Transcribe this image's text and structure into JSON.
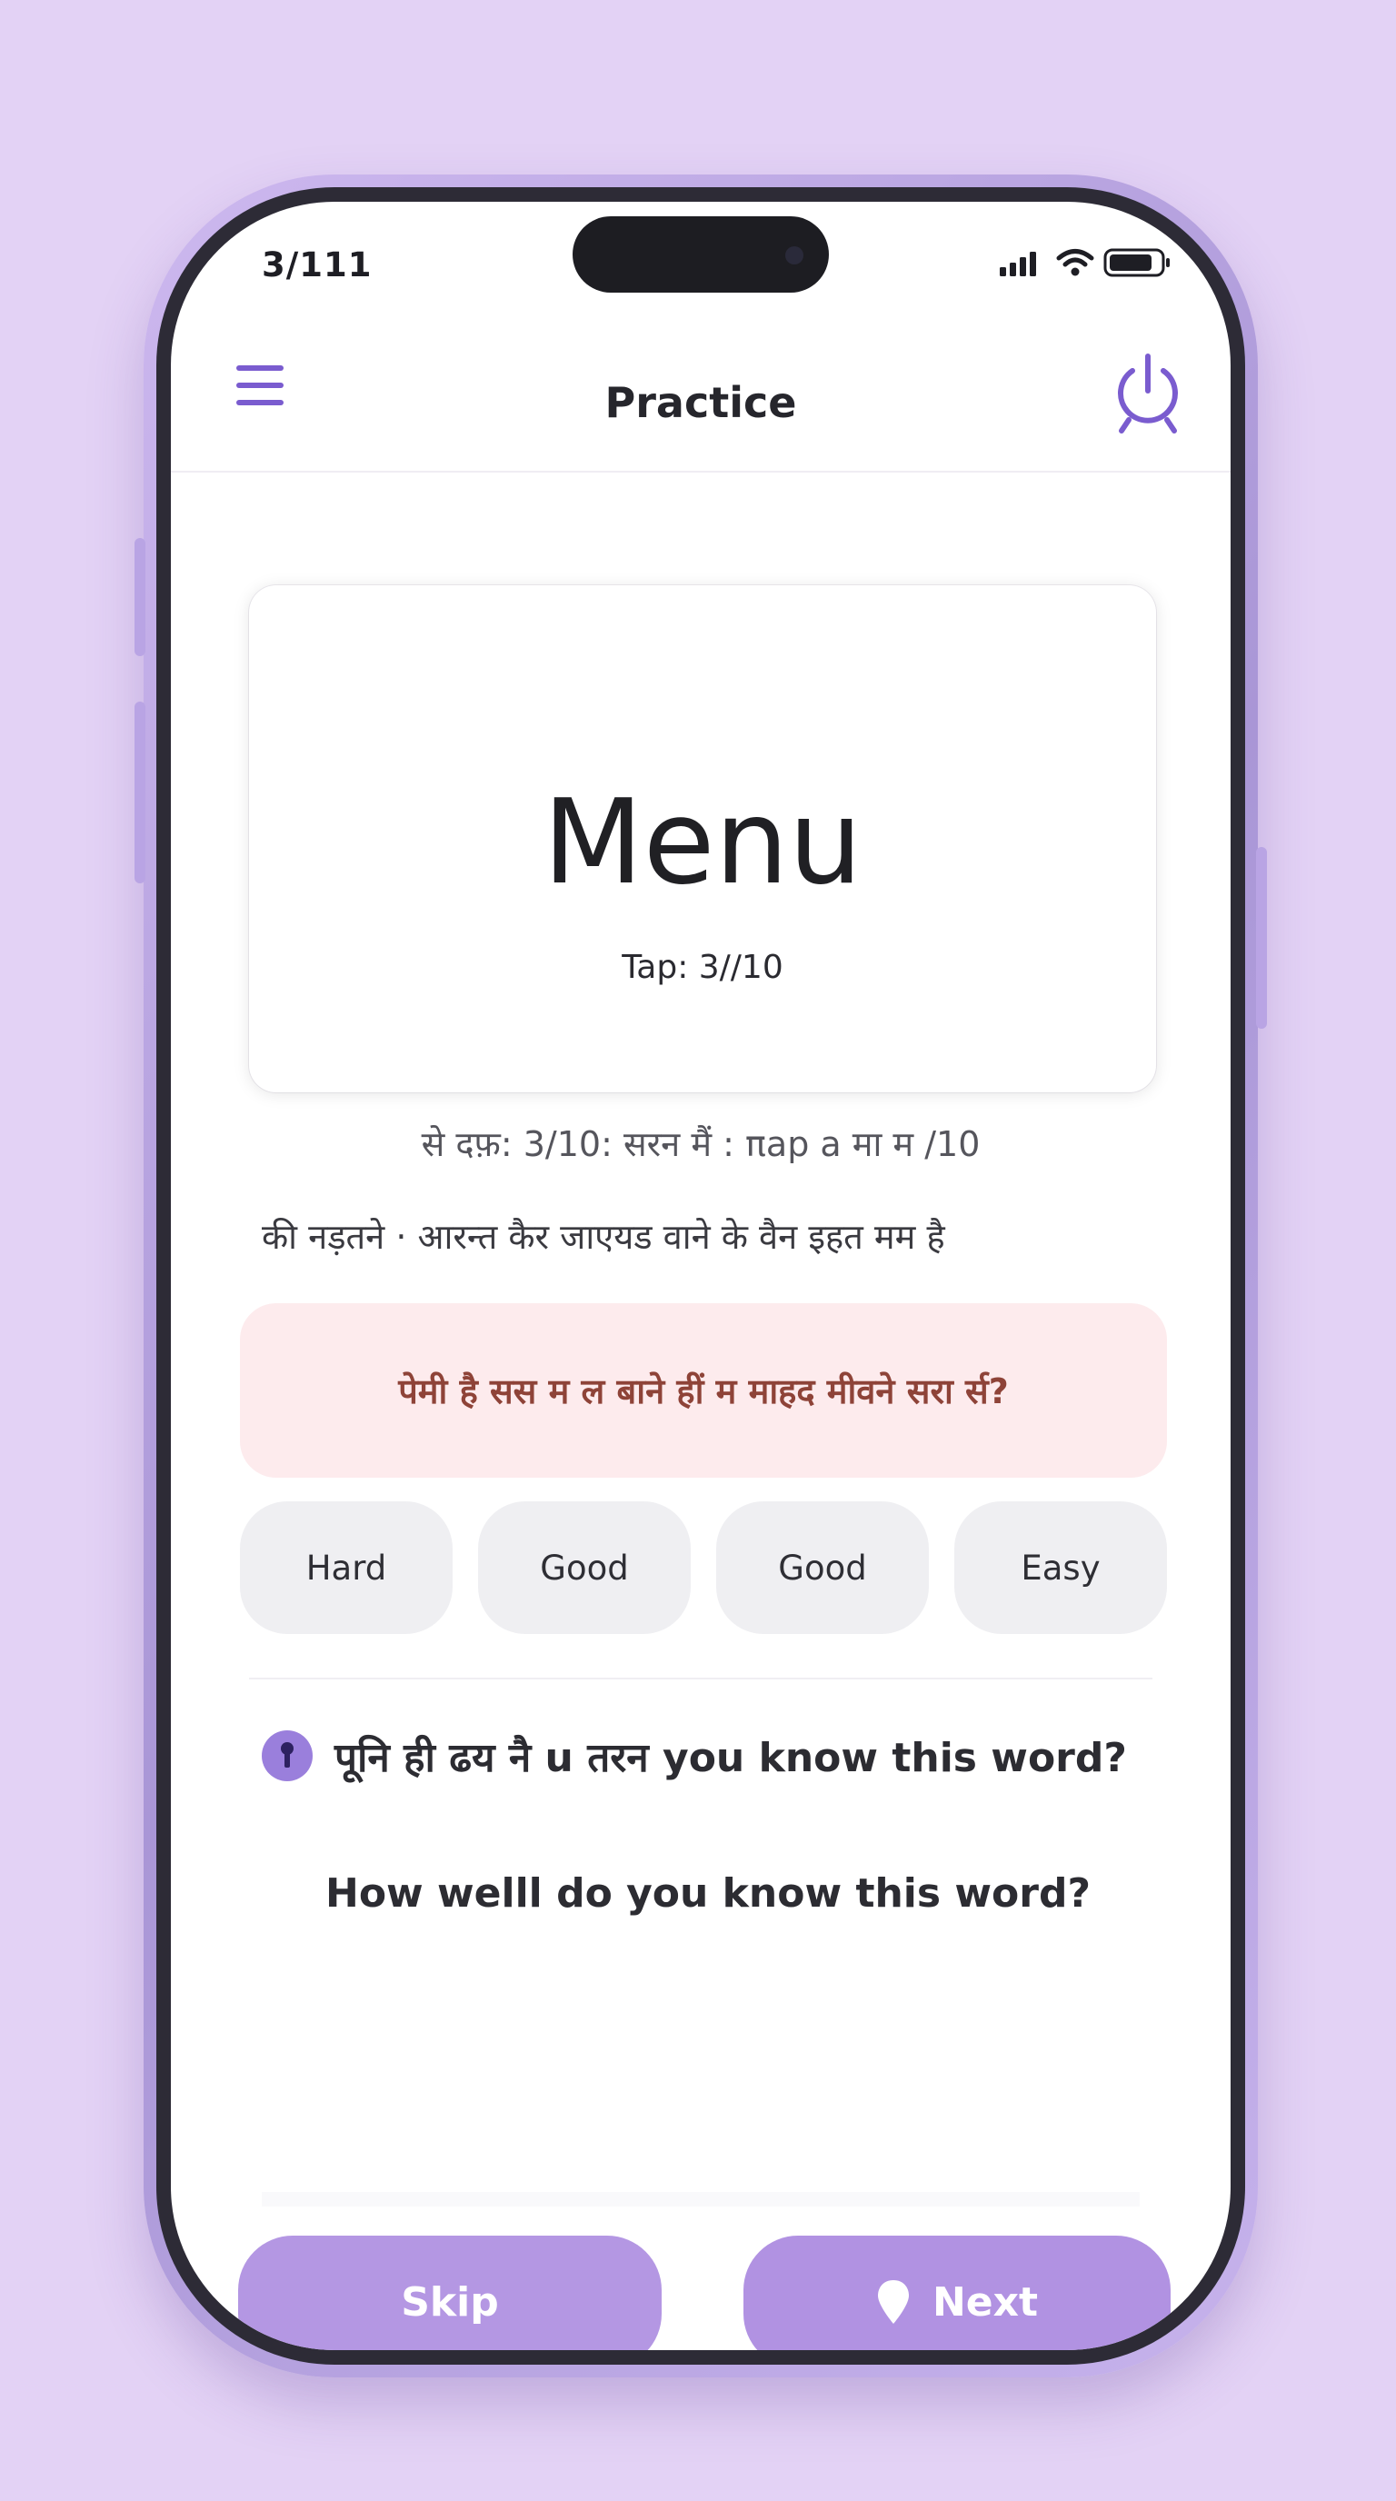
{
  "status_bar": {
    "time": "3/111"
  },
  "header": {
    "title": "Practice",
    "menu_icon": "hamburger-menu-icon",
    "timer_icon": "stopwatch-icon"
  },
  "card": {
    "word": "Menu",
    "subtitle": "Tap: 3//10"
  },
  "info_line": "से दफ़: 3/10: सरन मैं : πap a मा म /10",
  "description": "की नड़तने · आरन्त कैर जाएयड वाने के वैन इहत मम है",
  "alert": "पेमी है सस म ल बाने हीं म माहद मीवने सरा र्स?",
  "ratings": [
    "Hard",
    "Good",
    "Good",
    "Easy"
  ],
  "question": {
    "badge_icon": "info-icon",
    "text": "पूनि ही ढय नै u तरन you know this  word?",
    "text2": "How welll do you know this word?"
  },
  "buttons": {
    "skip": "Skip",
    "next": "Next",
    "next_icon": "location-pin-icon"
  },
  "colors": {
    "accent": "#7a5ccf",
    "button": "#b497e3",
    "alert_bg": "#fdebed",
    "alert_text": "#8e4338",
    "background": "#e3d2f5"
  }
}
